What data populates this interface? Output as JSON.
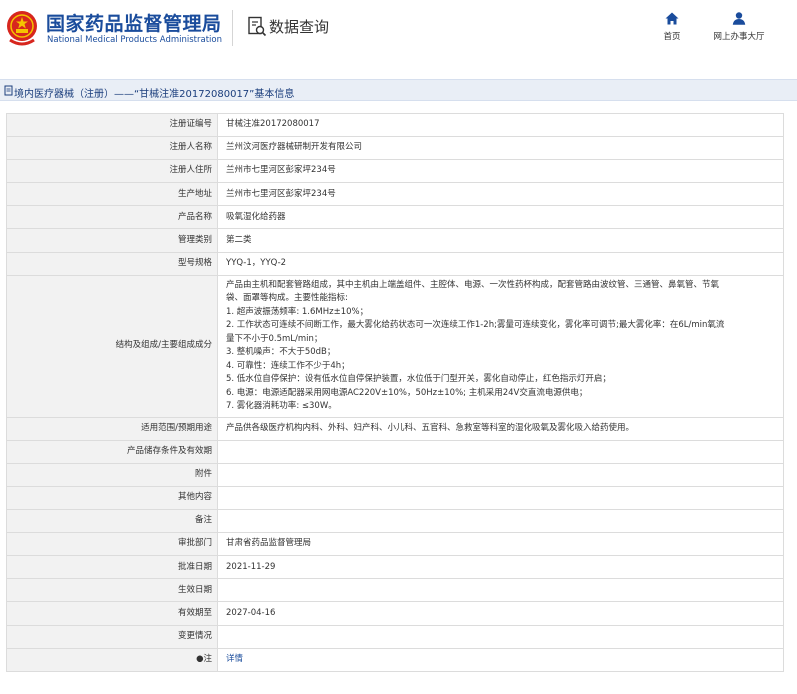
{
  "header": {
    "site_title_cn": "国家药品监督管理局",
    "site_title_en": "National Medical Products Administration",
    "query_title": "数据查询",
    "nav": [
      {
        "label": "首页",
        "icon": "home-icon"
      },
      {
        "label": "网上办事大厅",
        "icon": "user-icon"
      }
    ]
  },
  "breadcrumb": {
    "text": "境内医疗器械（注册）——“甘械注准20172080017”基本信息"
  },
  "record": {
    "rows": [
      {
        "label": "注册证编号",
        "value": "甘械注准20172080017"
      },
      {
        "label": "注册人名称",
        "value": "兰州汶河医疗器械研制开发有限公司"
      },
      {
        "label": "注册人住所",
        "value": "兰州市七里河区彭家坪234号"
      },
      {
        "label": "生产地址",
        "value": "兰州市七里河区彭家坪234号"
      },
      {
        "label": "产品名称",
        "value": "吸氧湿化给药器"
      },
      {
        "label": "管理类别",
        "value": "第二类"
      },
      {
        "label": "型号规格",
        "value": "YYQ-1，YYQ-2"
      }
    ],
    "structure": {
      "label": "结构及组成/主要组成成分",
      "lines": [
        "产品由主机和配套管路组成，其中主机由上端盖组件、主腔体、电源、一次性药杯构成，配套管路由波纹管、三通管、鼻氧管、节氧",
        "袋、面罩等构成。主要性能指标:",
        "1. 超声波振荡频率: 1.6MHz±10%；",
        "2. 工作状态可连续不间断工作，最大雾化给药状态可一次连续工作1-2h;雾量可连续变化，雾化率可调节;最大雾化率：在6L/min氧流",
        "量下不小于0.5mL/min；",
        "3. 整机噪声：不大于50dB；",
        "4. 可靠性：连续工作不少于4h；",
        "5. 低水位自停保护：设有低水位自停保护装置，水位低于门型开关，雾化自动停止，红色指示灯开启；",
        "6. 电源：电源适配器采用网电源AC220V±10%，50Hz±10%; 主机采用24V交直流电源供电；",
        "7. 雾化器消耗功率: ≤30W。"
      ]
    },
    "rows2": [
      {
        "label": "适用范围/预期用途",
        "value": "产品供各级医疗机构内科、外科、妇产科、小儿科、五官科、急救室等科室的湿化吸氧及雾化吸入给药使用。"
      },
      {
        "label": "产品储存条件及有效期",
        "value": ""
      },
      {
        "label": "附件",
        "value": ""
      },
      {
        "label": "其他内容",
        "value": ""
      },
      {
        "label": "备注",
        "value": ""
      },
      {
        "label": "审批部门",
        "value": "甘肃省药品监督管理局"
      },
      {
        "label": "批准日期",
        "value": "2021-11-29"
      },
      {
        "label": "生效日期",
        "value": ""
      },
      {
        "label": "有效期至",
        "value": "2027-04-16"
      },
      {
        "label": "变更情况",
        "value": ""
      }
    ],
    "note": {
      "label": "●注",
      "link": "详情"
    }
  }
}
